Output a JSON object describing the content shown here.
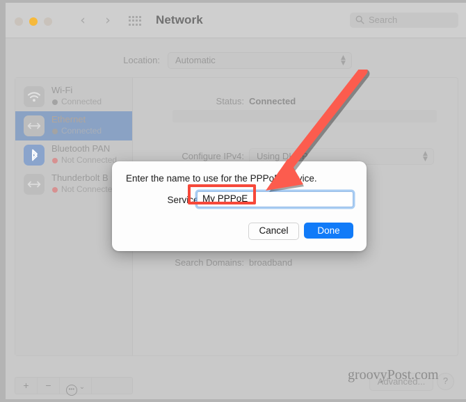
{
  "window": {
    "title": "Network",
    "traffic_lights": [
      "close",
      "minimize",
      "zoom"
    ],
    "nav_back": "‹",
    "nav_forward": "›",
    "grid_icon": "grid-icon",
    "search": {
      "placeholder": "Search",
      "icon": "search-icon"
    }
  },
  "location": {
    "label": "Location:",
    "value": "Automatic"
  },
  "sidebar": {
    "services": [
      {
        "name": "Wi-Fi",
        "status": "Connected",
        "icon": "wifi-icon",
        "status_color": "#a3a3a3",
        "selected": false
      },
      {
        "name": "Ethernet",
        "status": "Connected",
        "icon": "ethernet-icon",
        "status_color": "#a3a3a3",
        "selected": true
      },
      {
        "name": "Bluetooth PAN",
        "status": "Not Connected",
        "icon": "bluetooth-icon",
        "status_color": "#d79191",
        "selected": false
      },
      {
        "name": "Thunderbolt B",
        "status": "Not Connected",
        "icon": "thunderbolt-icon",
        "status_color": "#d79191",
        "selected": false
      }
    ],
    "toolbar": {
      "add": "+",
      "remove": "−",
      "action": "gear-icon",
      "action_chevron": "⌄"
    }
  },
  "detail": {
    "status_label": "Status:",
    "status_value": "Connected",
    "ipv4_label": "Configure IPv4:",
    "ipv4_value": "Using DHCP",
    "search_domains_label": "Search Domains:",
    "search_domains_value": "broadband"
  },
  "footer": {
    "advanced_button": "Advanced...",
    "help_button": "?"
  },
  "watermark": "groovyPost.com",
  "dialog": {
    "title": "Enter the name to use for the PPPoE Service.",
    "field_label": "Service Name:",
    "field_value": "My PPPoE",
    "cancel_button": "Cancel",
    "done_button": "Done",
    "done_color": "#117bf8"
  },
  "annotations": {
    "highlight_color": "#f6483a",
    "arrow_color": "#fc5c4e",
    "highlight_target": "service-name-input",
    "arrow_target": "service-name-input"
  }
}
